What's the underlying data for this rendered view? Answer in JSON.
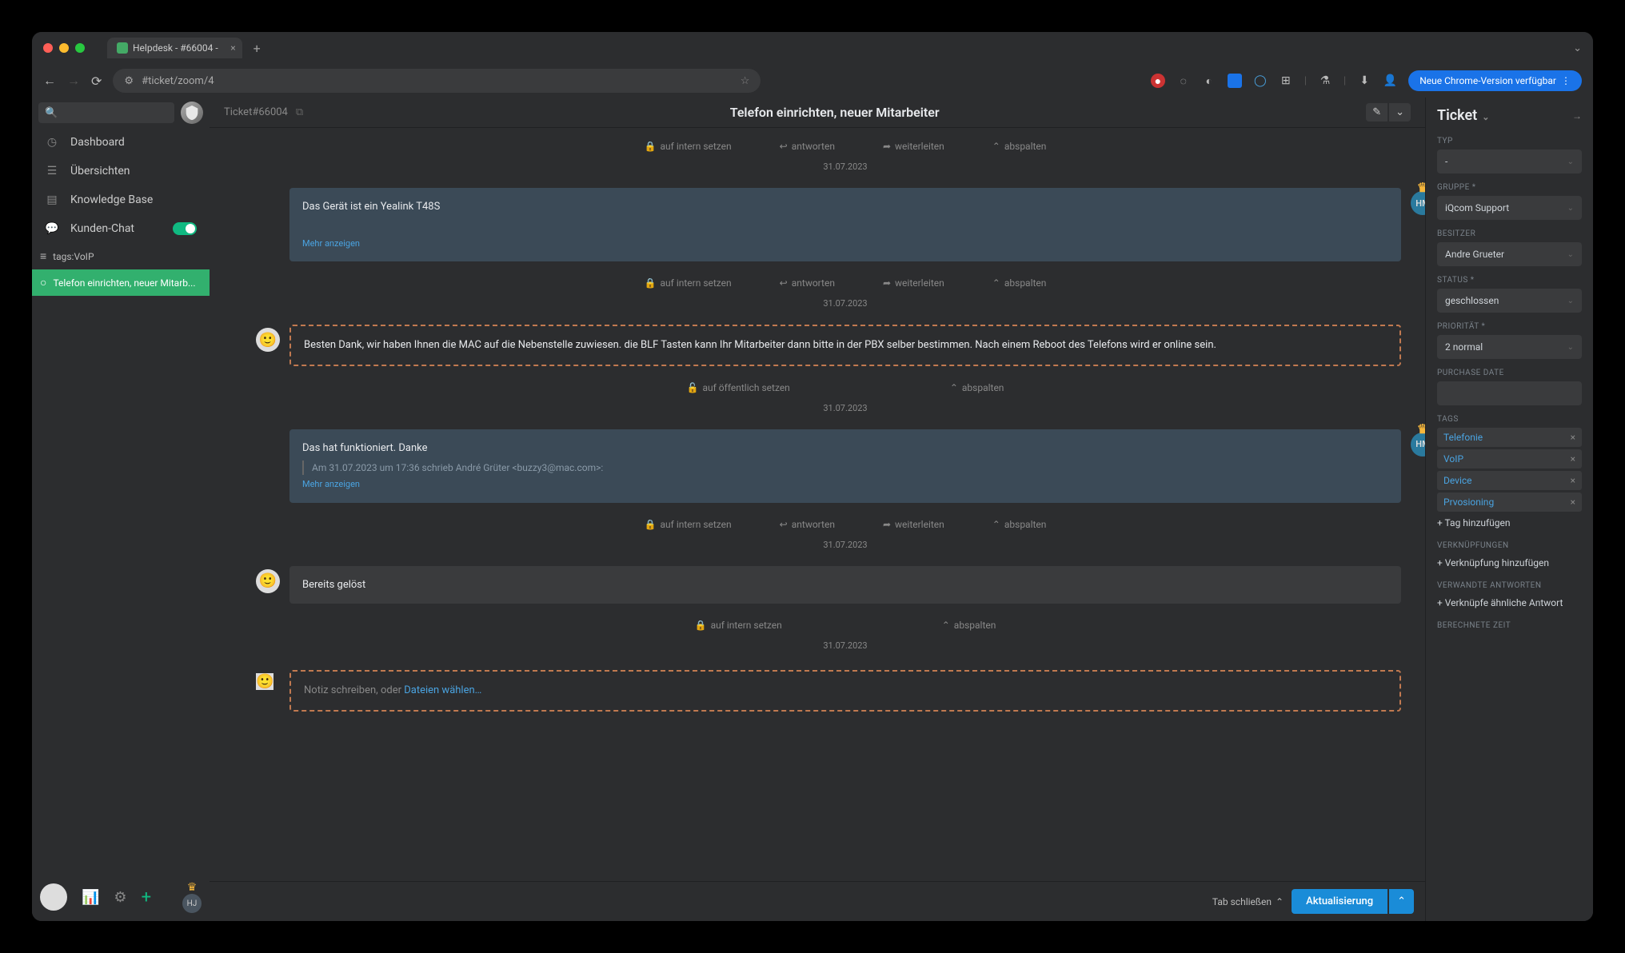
{
  "browser": {
    "tab_title": "Helpdesk - #66004 -",
    "url": "#ticket/zoom/4",
    "chrome_badge": "Neue Chrome-Version verfügbar"
  },
  "sidebar": {
    "items": [
      {
        "label": "Dashboard"
      },
      {
        "label": "Übersichten"
      },
      {
        "label": "Knowledge Base"
      },
      {
        "label": "Kunden-Chat"
      }
    ],
    "tabs": [
      {
        "label": "tags:VoIP",
        "active": false
      },
      {
        "label": "Telefon einrichten, neuer Mitarb...",
        "active": true
      }
    ],
    "hm_initials": "HJ"
  },
  "ticket": {
    "number": "Ticket#66004",
    "title": "Telefon einrichten, neuer Mitarbeiter"
  },
  "thread": {
    "actions": {
      "internal": "auf intern setzen",
      "public": "auf öffentlich setzen",
      "internal_setzen": "auf intern setzen",
      "reply": "antworten",
      "forward": "weiterleiten",
      "split": "abspalten"
    },
    "date": "31.07.2023",
    "messages": [
      {
        "body": "Das Gerät ist ein Yealink T48S",
        "more": "Mehr anzeigen"
      },
      {
        "body": "Besten Dank, wir haben Ihnen die MAC auf die Nebenstelle zuwiesen. die BLF Tasten kann Ihr Mitarbeiter dann bitte in der PBX selber bestimmen. Nach einem Reboot des Telefons wird er online sein."
      },
      {
        "body": "Das hat funktioniert. Danke",
        "quote": "Am 31.07.2023 um 17:36 schrieb André Grüter <buzzy3@mac.com>:",
        "more": "Mehr anzeigen"
      },
      {
        "body": "Bereits gelöst"
      }
    ],
    "compose_prefix": "Notiz schreiben, oder ",
    "compose_link": "Dateien wählen…",
    "hm_initials": "HM"
  },
  "rpanel": {
    "heading": "Ticket",
    "fields": {
      "typ": {
        "label": "Typ",
        "value": "-"
      },
      "gruppe": {
        "label": "Gruppe *",
        "value": "iQcom Support"
      },
      "besitzer": {
        "label": "Besitzer",
        "value": "Andre Grueter"
      },
      "status": {
        "label": "Status *",
        "value": "geschlossen"
      },
      "prio": {
        "label": "Priorität *",
        "value": "2 normal"
      },
      "purchase": {
        "label": "Purchase Date"
      }
    },
    "tags_label": "Tags",
    "tags": [
      "Telefonie",
      "VoIP",
      "Device",
      "Prvosioning"
    ],
    "add_tag": "+ Tag hinzufügen",
    "links_label": "Verknüpfungen",
    "add_link": "+ Verknüpfung hinzufügen",
    "related_label": "Verwandte Antworten",
    "add_related": "+ Verknüpfe ähnliche Antwort",
    "time_label": "Berechnete Zeit"
  },
  "footer": {
    "tab_close": "Tab schließen",
    "update": "Aktualisierung"
  }
}
